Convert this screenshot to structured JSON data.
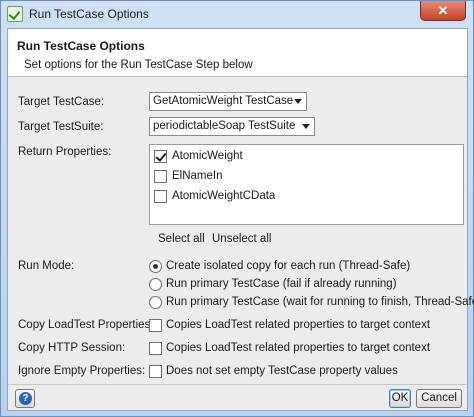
{
  "window": {
    "title": "Run TestCase Options",
    "close_label": "✕"
  },
  "header": {
    "title": "Run TestCase Options",
    "description": "Set options for the Run TestCase Step below"
  },
  "form": {
    "target_testcase": {
      "label": "Target TestCase:",
      "value": "GetAtomicWeight TestCase"
    },
    "target_testsuite": {
      "label": "Target TestSuite:",
      "value": "periodictableSoap TestSuite"
    },
    "return_properties": {
      "label": "Return Properties:",
      "items": [
        {
          "label": "AtomicWeight",
          "checked": true
        },
        {
          "label": "ElNameIn",
          "checked": false
        },
        {
          "label": "AtomicWeightCData",
          "checked": false
        }
      ],
      "select_all": "Select all",
      "unselect_all": "Unselect all"
    },
    "run_mode": {
      "label": "Run Mode:",
      "options": [
        {
          "label": "Create isolated copy for each run (Thread-Safe)",
          "selected": true
        },
        {
          "label": "Run primary TestCase (fail if already running)",
          "selected": false
        },
        {
          "label": "Run primary TestCase (wait for running to finish, Thread-Safe)",
          "selected": false
        }
      ]
    },
    "copy_loadtest": {
      "label": "Copy LoadTest Properties:",
      "option": "Copies LoadTest related properties to target context",
      "checked": false
    },
    "copy_http": {
      "label": "Copy HTTP Session:",
      "option": "Copies LoadTest related properties to target context",
      "checked": false
    },
    "ignore_empty": {
      "label": "Ignore Empty Properties:",
      "option": "Does not set empty TestCase property values",
      "checked": false
    }
  },
  "footer": {
    "help_icon": "?",
    "ok": "OK",
    "cancel": "Cancel"
  }
}
